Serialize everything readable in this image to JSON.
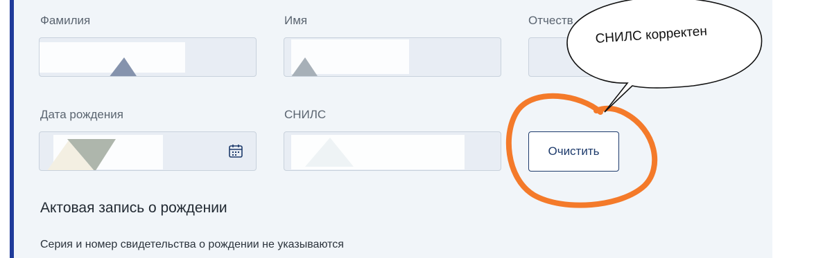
{
  "form": {
    "last_name_label": "Фамилия",
    "first_name_label": "Имя",
    "patronymic_label": "Отчеств",
    "birth_date_label": "Дата рождения",
    "snils_label": "СНИЛС",
    "clear_button_label": "Очистить",
    "section_title": "Актовая запись о рождении",
    "note_text": "Серия и номер свидетельства о рождении не указываются"
  },
  "annotation": {
    "bubble_text": "СНИЛС корректен",
    "circle_color": "#f47a2a"
  },
  "colors": {
    "accent_border": "#1f3b9a",
    "button_text": "#1d3a6b"
  },
  "icons": {
    "calendar": "calendar-icon"
  }
}
